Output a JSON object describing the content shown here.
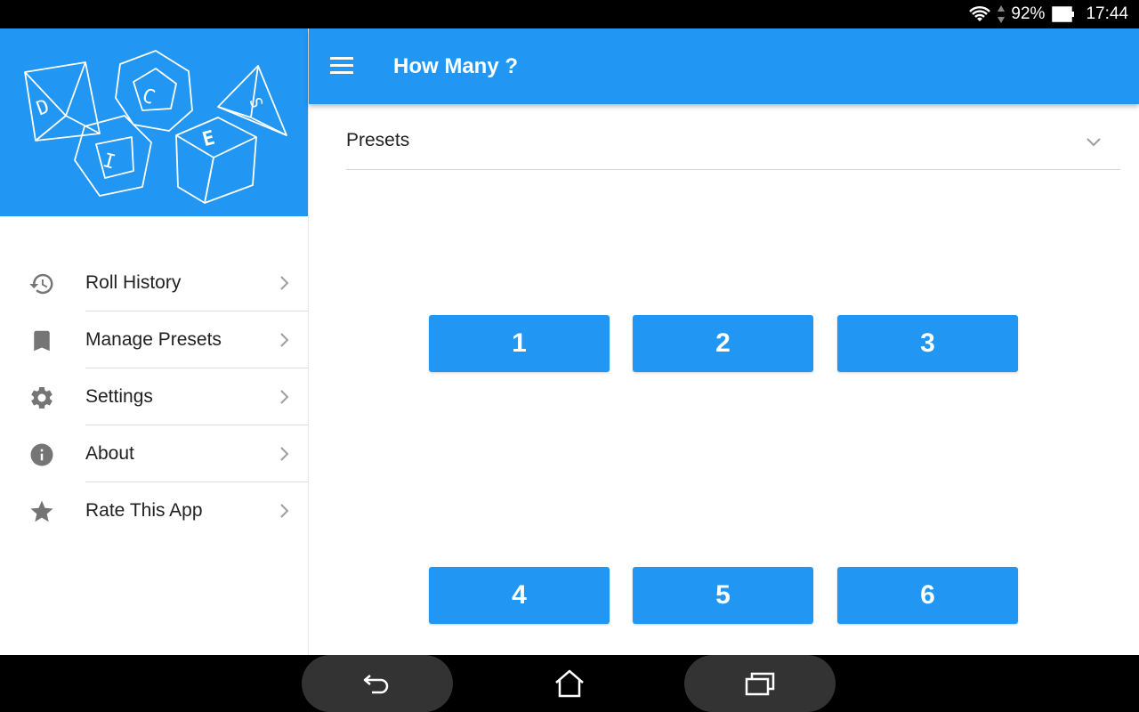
{
  "status_bar": {
    "battery_percent": "92%",
    "time": "17:44",
    "icons": [
      "wifi-icon",
      "data-arrows-icon",
      "battery-icon"
    ]
  },
  "drawer": {
    "header_image": "dice-illustration",
    "header_letters": [
      "D",
      "I",
      "C",
      "E",
      "S"
    ],
    "items": [
      {
        "label": "Roll History",
        "icon": "history-icon"
      },
      {
        "label": "Manage Presets",
        "icon": "bookmark-icon"
      },
      {
        "label": "Settings",
        "icon": "gear-icon"
      },
      {
        "label": "About",
        "icon": "info-icon"
      },
      {
        "label": "Rate This App",
        "icon": "star-icon"
      }
    ]
  },
  "appbar": {
    "title": "How Many ?",
    "menu_icon": "hamburger-icon"
  },
  "presets": {
    "label": "Presets"
  },
  "count_buttons": [
    "1",
    "2",
    "3",
    "4",
    "5",
    "6"
  ],
  "colors": {
    "primary": "#2196f3",
    "text": "#212121",
    "icon_grey": "#757575"
  },
  "nav_bar": {
    "buttons": [
      "back-icon",
      "home-icon",
      "recent-apps-icon"
    ]
  }
}
